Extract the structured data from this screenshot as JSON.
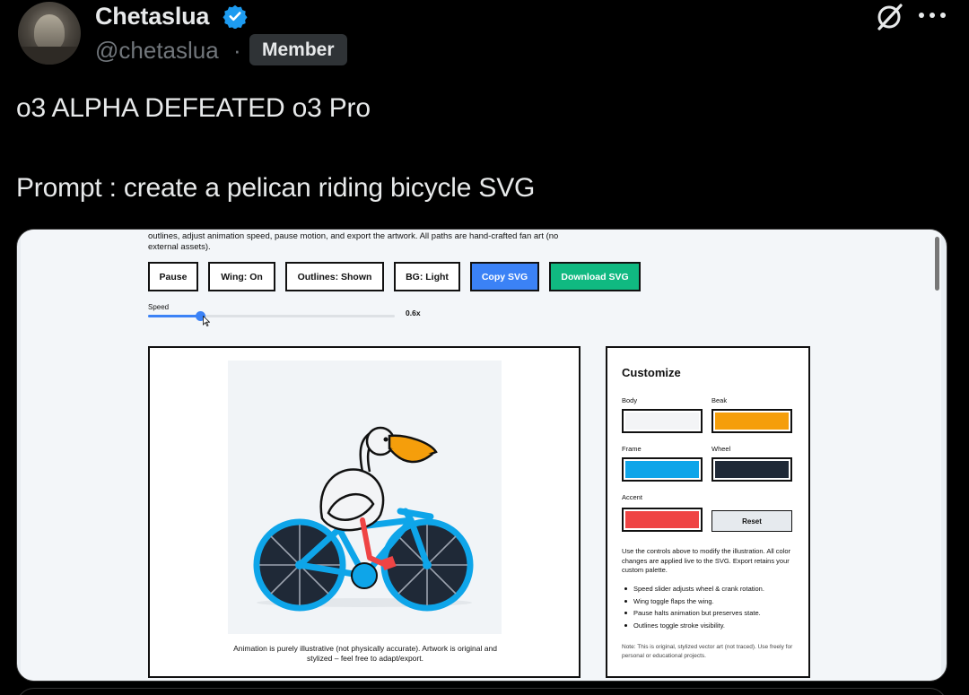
{
  "tweet": {
    "author_name": "Chetaslua",
    "handle": "@chetaslua",
    "separator": "·",
    "badge": "Member",
    "line1": "o3 ALPHA DEFEATED o3 Pro",
    "line2": "Prompt : create a pelican riding bicycle SVG"
  },
  "app": {
    "intro": "outlines, adjust animation speed, pause motion, and export the artwork. All paths are hand-crafted fan art (no external assets).",
    "buttons": {
      "pause": "Pause",
      "wing": "Wing: On",
      "outlines": "Outlines: Shown",
      "bg": "BG: Light",
      "copy": "Copy SVG",
      "download": "Download SVG"
    },
    "speed": {
      "label": "Speed",
      "value_text": "0.6x",
      "value": 0.6,
      "fraction": 0.21
    },
    "caption": "Animation is purely illustrative (not physically accurate). Artwork is original and stylized – feel free to adapt/export.",
    "panel": {
      "title": "Customize",
      "body_label": "Body",
      "beak_label": "Beak",
      "frame_label": "Frame",
      "wheel_label": "Wheel",
      "accent_label": "Accent",
      "reset": "Reset",
      "description": "Use the controls above to modify the illustration. All color changes are applied live to the SVG. Export retains your custom palette.",
      "tips": [
        "Speed slider adjusts wheel & crank rotation.",
        "Wing toggle flaps the wing.",
        "Pause halts animation but preserves state.",
        "Outlines toggle stroke visibility."
      ],
      "note": "Note: This is original, stylized vector art (not traced). Use freely for personal or educational projects."
    }
  },
  "colors": {
    "body": "#f3f4f6",
    "beak": "#f59e0b",
    "frame": "#0ea5e9",
    "wheel": "#1f2937",
    "accent": "#ef4444",
    "verified": "#1d9bf0",
    "copy_button": "#3b82f6",
    "download_button": "#10b981"
  },
  "icons": {
    "verified": "verified-badge-icon",
    "grok": "grok-icon",
    "more": "more-icon",
    "cursor": "cursor-icon"
  }
}
